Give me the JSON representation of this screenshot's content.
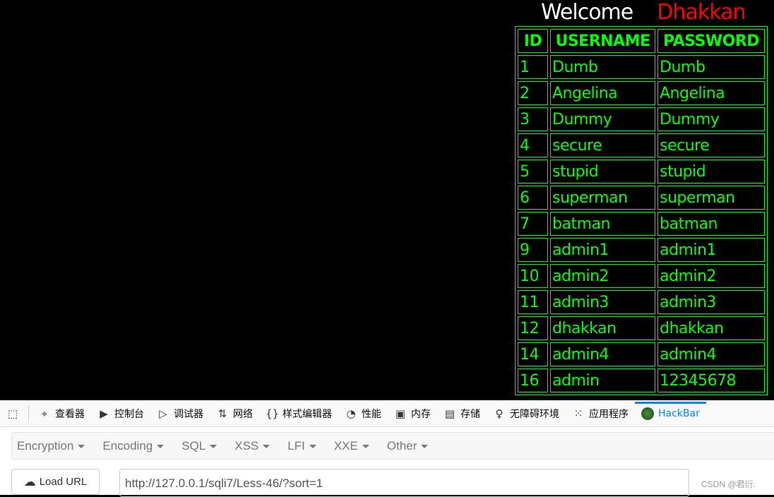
{
  "page": {
    "welcome": "Welcome",
    "name": "Dhakkan",
    "table": {
      "headers": [
        "ID",
        "USERNAME",
        "PASSWORD"
      ],
      "rows": [
        [
          "1",
          "Dumb",
          "Dumb"
        ],
        [
          "2",
          "Angelina",
          "Angelina"
        ],
        [
          "3",
          "Dummy",
          "Dummy"
        ],
        [
          "4",
          "secure",
          "secure"
        ],
        [
          "5",
          "stupid",
          "stupid"
        ],
        [
          "6",
          "superman",
          "superman"
        ],
        [
          "7",
          "batman",
          "batman"
        ],
        [
          "9",
          "admin1",
          "admin1"
        ],
        [
          "10",
          "admin2",
          "admin2"
        ],
        [
          "11",
          "admin3",
          "admin3"
        ],
        [
          "12",
          "dhakkan",
          "dhakkan"
        ],
        [
          "14",
          "admin4",
          "admin4"
        ],
        [
          "16",
          "admin",
          "12345678"
        ]
      ]
    }
  },
  "devtools": {
    "tabs": [
      {
        "icon": "inspector-icon",
        "label": "查看器"
      },
      {
        "icon": "console-icon",
        "label": "控制台"
      },
      {
        "icon": "debugger-icon",
        "label": "调试器"
      },
      {
        "icon": "network-icon",
        "label": "网络"
      },
      {
        "icon": "style-editor-icon",
        "label": "样式编辑器"
      },
      {
        "icon": "performance-icon",
        "label": "性能"
      },
      {
        "icon": "memory-icon",
        "label": "内存"
      },
      {
        "icon": "storage-icon",
        "label": "存储"
      },
      {
        "icon": "accessibility-icon",
        "label": "无障碍环境"
      },
      {
        "icon": "application-icon",
        "label": "应用程序"
      },
      {
        "icon": "hackbar-icon",
        "label": "HackBar",
        "active": true
      }
    ]
  },
  "hackbar": {
    "menus": [
      "Encryption",
      "Encoding",
      "SQL",
      "XSS",
      "LFI",
      "XXE",
      "Other"
    ],
    "load_url": "Load URL",
    "url": "http://127.0.0.1/sqli7/Less-46/?sort=1"
  },
  "watermark": "CSDN @君衍.",
  "colors": {
    "table": "#00ff00",
    "name": "#ff0000",
    "active_tab": "#0a84ff"
  }
}
